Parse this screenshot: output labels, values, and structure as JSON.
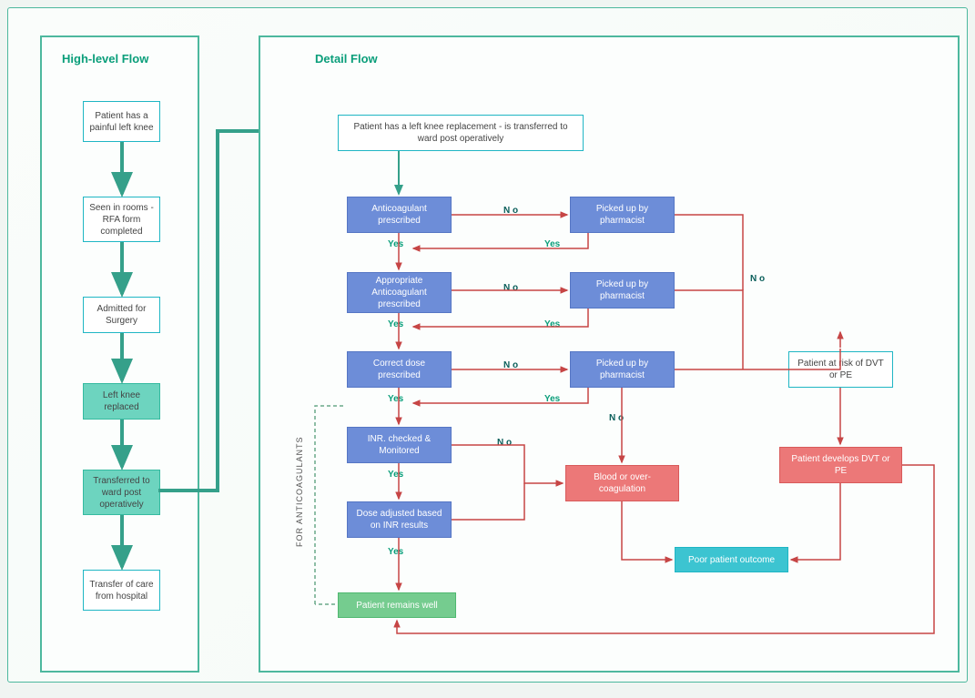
{
  "titles": {
    "high": "High-level Flow",
    "detail": "Detail Flow"
  },
  "high": {
    "n1": "Patient has a painful left knee",
    "n2": "Seen in rooms - RFA form completed",
    "n3": "Admitted for Surgery",
    "n4": "Left knee replaced",
    "n5": "Transferred to ward post operatively",
    "n6": "Transfer of care from hospital"
  },
  "detail": {
    "start": "Patient has a left knee replacement - is transferred to ward post operatively",
    "d1": "Anticoagulant prescribed",
    "d2": "Appropriate Anticoagulant prescribed",
    "d3": "Correct dose prescribed",
    "d4": "INR. checked & Monitored",
    "d5": "Dose adjusted based on INR results",
    "p1": "Picked up by pharmacist",
    "p2": "Picked up by pharmacist",
    "p3": "Picked up by pharmacist",
    "risk": "Patient at risk of DVT or PE",
    "dvt": "Patient develops DVT or PE",
    "blood": "Blood or over-coagulation",
    "poor": "Poor patient outcome",
    "well": "Patient remains well",
    "sidenote": "FOR ANTICOAGULANTS"
  },
  "labels": {
    "yes": "Yes",
    "no": "N o"
  }
}
